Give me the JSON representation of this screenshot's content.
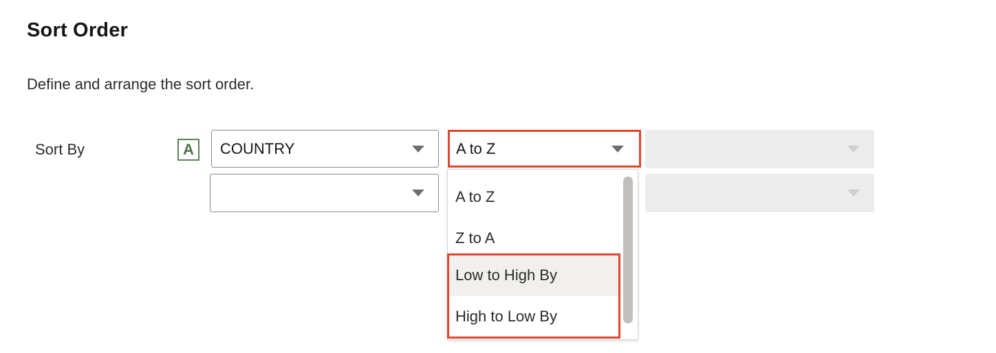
{
  "section": {
    "title": "Sort Order",
    "description": "Define and arrange the sort order."
  },
  "sort_by": {
    "label": "Sort By",
    "badge_letter": "A",
    "rows": [
      {
        "column": "COUNTRY",
        "order": "A to Z",
        "by": ""
      },
      {
        "column": "",
        "order": "",
        "by": ""
      }
    ]
  },
  "order_dropdown": {
    "options": [
      "A to Z",
      "Z to A",
      "Low to High By",
      "High to Low By"
    ],
    "hovered": "Low to High By"
  },
  "colors": {
    "highlight": "#e2452c",
    "badge": "#5b7f55",
    "disabled_field": "#ececec"
  }
}
